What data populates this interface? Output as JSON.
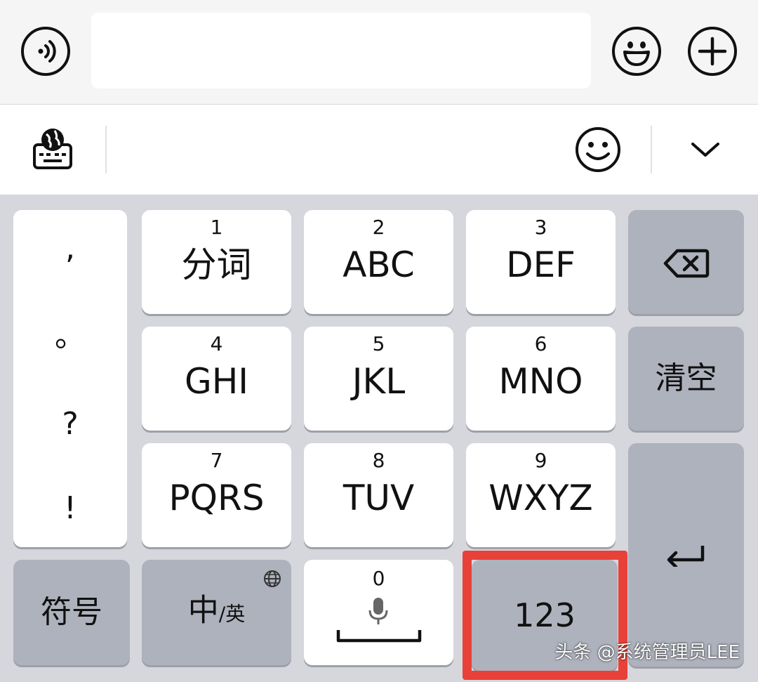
{
  "top_bar": {
    "voice_icon": "voice-wave-icon",
    "emoji_icon": "smiley-face-icon",
    "add_icon": "plus-icon",
    "input_value": ""
  },
  "toolbar": {
    "keyboard_icon": "globe-keyboard-icon",
    "emoji_icon": "smiley-outline-icon",
    "collapse_icon": "chevron-down-icon"
  },
  "keyboard": {
    "punctuation": [
      ",",
      "。",
      "?",
      "!"
    ],
    "keys": [
      {
        "num": "1",
        "label": "分词"
      },
      {
        "num": "2",
        "label": "ABC"
      },
      {
        "num": "3",
        "label": "DEF"
      },
      {
        "num": "4",
        "label": "GHI"
      },
      {
        "num": "5",
        "label": "JKL"
      },
      {
        "num": "6",
        "label": "MNO"
      },
      {
        "num": "7",
        "label": "PQRS"
      },
      {
        "num": "8",
        "label": "TUV"
      },
      {
        "num": "9",
        "label": "WXYZ"
      }
    ],
    "backspace_icon": "backspace-icon",
    "clear_label": "清空",
    "enter_icon": "enter-return-icon",
    "symbol_label": "符号",
    "lang_main": "中",
    "lang_sub": "/英",
    "lang_globe_icon": "globe-icon",
    "zero_num": "0",
    "mic_icon": "microphone-icon",
    "space_icon": "space-bar-icon",
    "numeric_label": "123"
  },
  "watermark": "头条 @系统管理员LEE",
  "colors": {
    "highlight": "#e8413a",
    "key_white": "#ffffff",
    "key_gray": "#aeb2bd",
    "keyboard_bg": "#d6d7dc"
  }
}
